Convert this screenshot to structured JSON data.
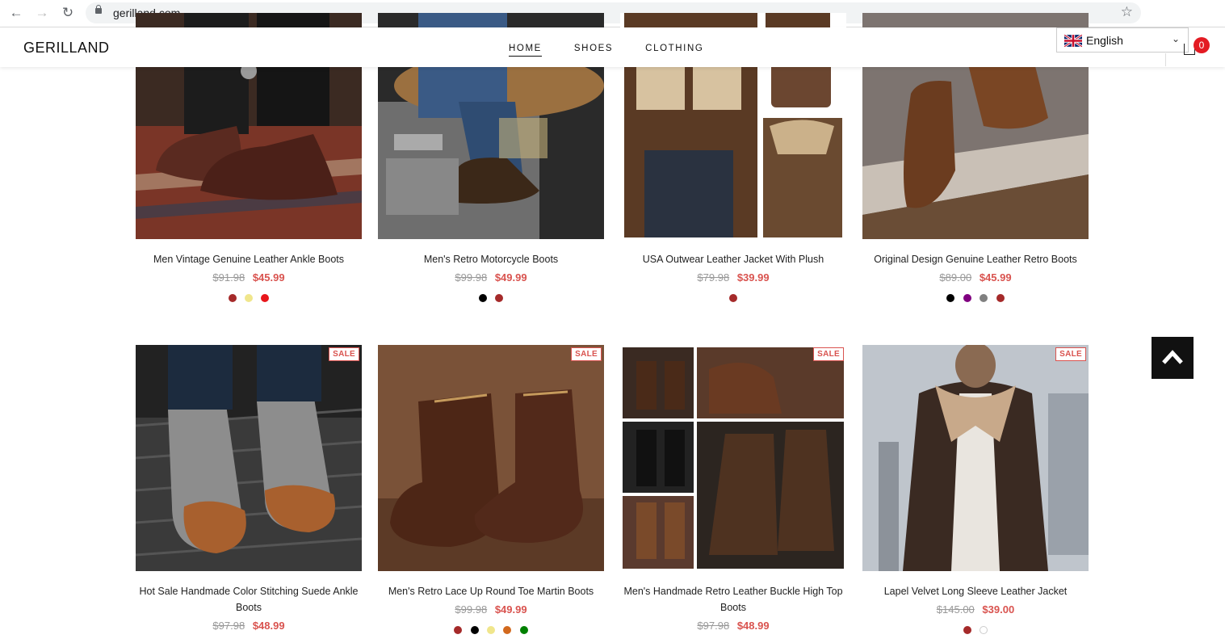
{
  "browser": {
    "url": "gerilland.com",
    "back_icon": "back-arrow-icon",
    "forward_icon": "forward-arrow-icon",
    "reload_icon": "reload-icon",
    "bookmark_icon": "star-icon"
  },
  "header": {
    "logo": "GERILLAND",
    "menu": [
      "HOME",
      "SHOES",
      "CLOTHING"
    ],
    "language": "English",
    "cart_count": "0"
  },
  "colors": {
    "sale_red": "#d9534f",
    "badge_red": "#e31b23"
  },
  "products_row1": [
    {
      "title": "Men Vintage Genuine Leather Ankle Boots",
      "old_price": "$91.98",
      "price": "$45.99",
      "swatches": [
        "#a52a2a",
        "#f0e68c",
        "#e8161b"
      ]
    },
    {
      "title": "Men's Retro Motorcycle Boots",
      "old_price": "$99.98",
      "price": "$49.99",
      "swatches": [
        "#000000",
        "#a52a2a"
      ]
    },
    {
      "title": "USA Outwear Leather Jacket With Plush",
      "old_price": "$79.98",
      "price": "$39.99",
      "swatches": [
        "#a52a2a"
      ]
    },
    {
      "title": "Original Design Genuine Leather Retro Boots",
      "old_price": "$89.00",
      "price": "$45.99",
      "swatches": [
        "#000000",
        "#800080",
        "#808080",
        "#a52a2a"
      ]
    }
  ],
  "products_row2": [
    {
      "title": "Hot Sale Handmade Color Stitching Suede Ankle Boots",
      "old_price": "$97.98",
      "price": "$48.99",
      "sale": "SALE",
      "swatches": []
    },
    {
      "title": "Men's Retro Lace Up Round Toe Martin Boots",
      "old_price": "$99.98",
      "price": "$49.99",
      "sale": "SALE",
      "swatches": [
        "#a52a2a",
        "#000000",
        "#f0e68c",
        "#d2691e",
        "#008000"
      ]
    },
    {
      "title": "Men's Handmade Retro Leather Buckle High Top Boots",
      "old_price": "$97.98",
      "price": "$48.99",
      "sale": "SALE",
      "swatches": []
    },
    {
      "title": "Lapel Velvet Long Sleeve Leather Jacket",
      "old_price": "$145.00",
      "price": "$39.00",
      "sale": "SALE",
      "swatches": [
        "#a52a2a",
        "#ffffff"
      ]
    }
  ]
}
